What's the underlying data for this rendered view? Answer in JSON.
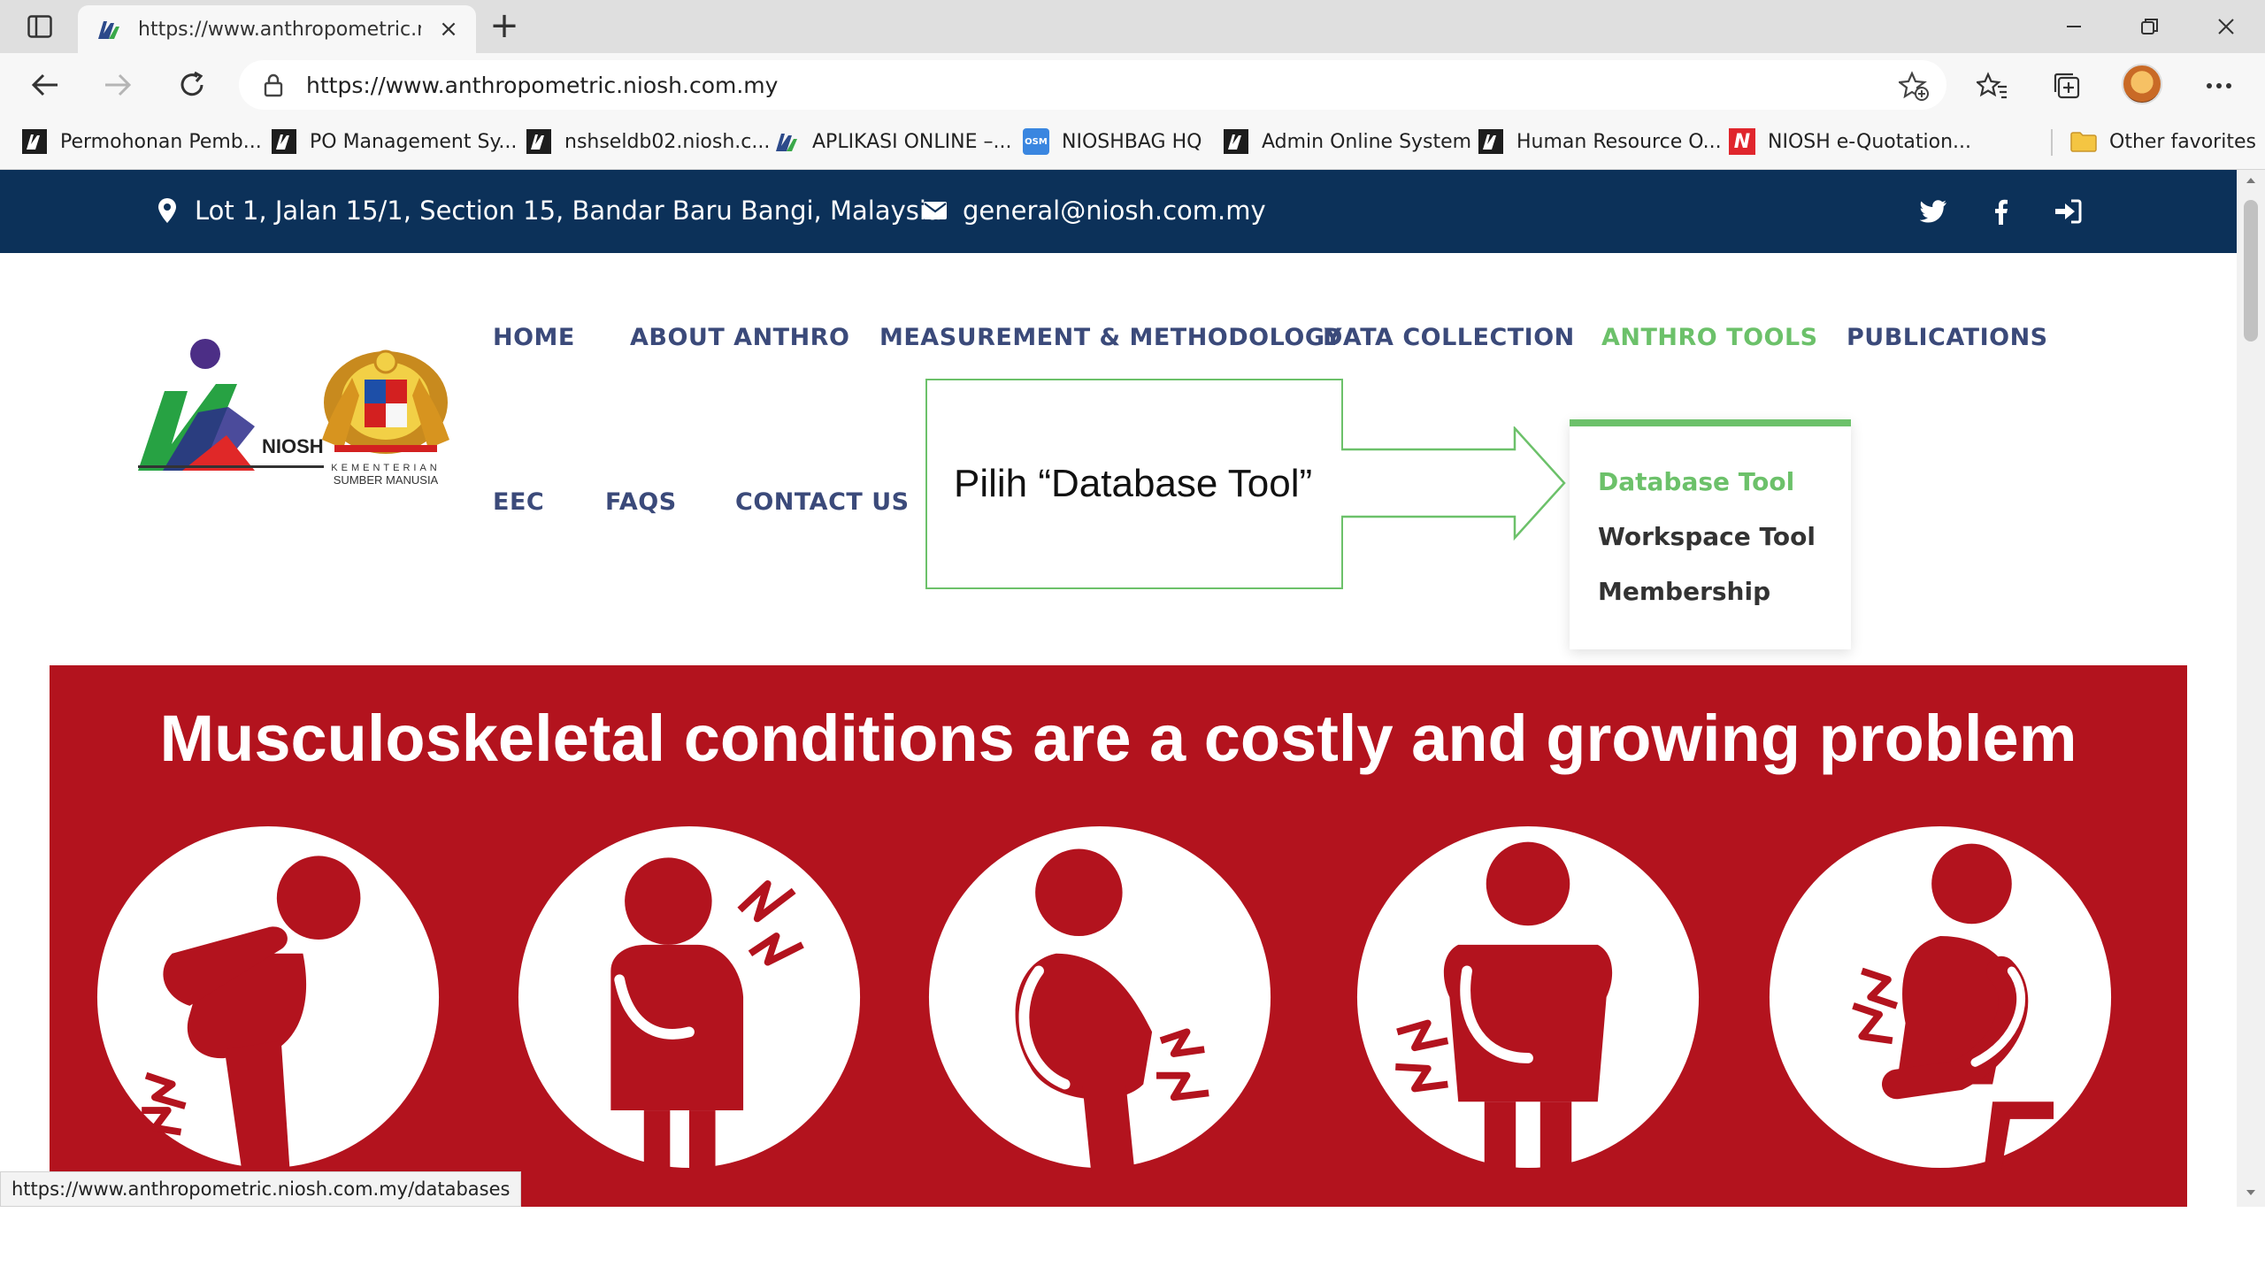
{
  "browser": {
    "tab": {
      "title": "https://www.anthropometric.niosh.com.my"
    },
    "address": {
      "url": "https://www.anthropometric.niosh.com.my"
    },
    "bookmarks": [
      {
        "label": "Permohonan Pemb...",
        "icon": "niosh-favicon"
      },
      {
        "label": "PO Management Sy...",
        "icon": "niosh-favicon"
      },
      {
        "label": "nshseldb02.niosh.c...",
        "icon": "niosh-favicon"
      },
      {
        "label": "APLIKASI ONLINE –...",
        "icon": "niosh-favicon"
      },
      {
        "label": "NIOSHBAG HQ",
        "icon": "osm-favicon",
        "icon_text": "OSM"
      },
      {
        "label": "Admin Online System",
        "icon": "niosh-favicon"
      },
      {
        "label": "Human Resource O...",
        "icon": "niosh-favicon"
      },
      {
        "label": "NIOSH e-Quotation...",
        "icon": "niosh-red-n-favicon",
        "icon_text": "N"
      }
    ],
    "other_favorites": "Other favorites",
    "status_url": "https://www.anthropometric.niosh.com.my/databases"
  },
  "site": {
    "topbar": {
      "address": "Lot 1, Jalan 15/1, Section 15, Bandar Baru Bangi, Malaysia",
      "email": "general@niosh.com.my",
      "background": "#0c3159"
    },
    "logo": {
      "niosh_text": "NIOSH",
      "ministry_line1": "KEMENTERIAN",
      "ministry_line2": "SUMBER MANUSIA"
    },
    "menu": {
      "home": "HOME",
      "about": "ABOUT ANTHRO",
      "measurement": "MEASUREMENT & METHODOLOGY",
      "data_collection": "DATA COLLECTION",
      "anthro_tools": "ANTHRO TOOLS",
      "publications": "PUBLICATIONS",
      "eec": "EEC",
      "faqs": "FAQS",
      "contact": "CONTACT US"
    },
    "dropdown": {
      "database_tool": "Database Tool",
      "workspace_tool": "Workspace Tool",
      "membership": "Membership"
    },
    "callout": "Pilih “Database Tool”",
    "banner": {
      "title": "Musculoskeletal conditions are a costly and growing problem",
      "background": "#b3131e"
    },
    "accent": "#6cc16a"
  }
}
